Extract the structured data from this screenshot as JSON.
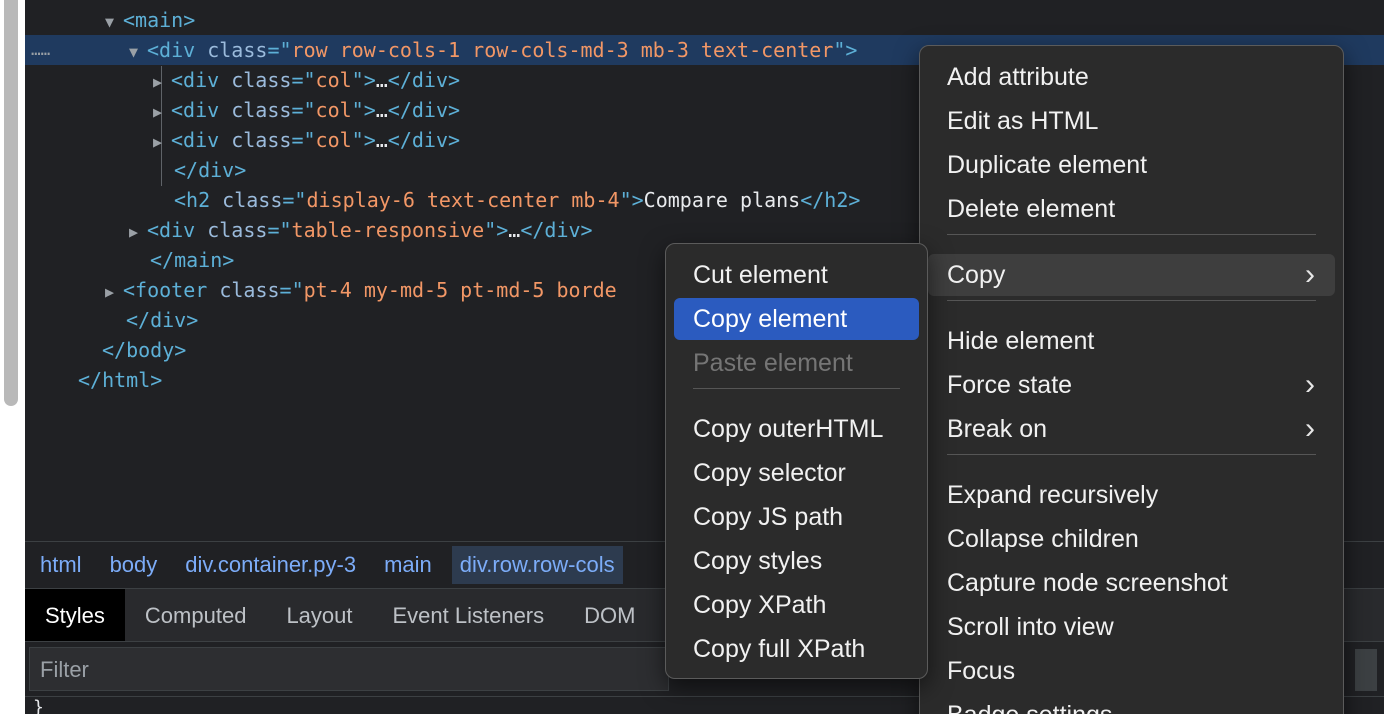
{
  "dom_tree": {
    "lines": [
      {
        "indent": 80,
        "arrow": "▼",
        "parts": [
          {
            "c": "tag",
            "t": "<main>"
          }
        ]
      },
      {
        "indent": 104,
        "arrow": "▼",
        "selected": true,
        "parts": [
          {
            "c": "tag",
            "t": "<div "
          },
          {
            "c": "attr",
            "t": "class"
          },
          {
            "c": "tag",
            "t": "=\""
          },
          {
            "c": "val",
            "t": "row row-cols-1 row-cols-md-3 mb-3 text-center"
          },
          {
            "c": "tag",
            "t": "\">"
          }
        ]
      },
      {
        "indent": 128,
        "arrow": "▶",
        "parts": [
          {
            "c": "tag",
            "t": "<div "
          },
          {
            "c": "attr",
            "t": "class"
          },
          {
            "c": "tag",
            "t": "=\""
          },
          {
            "c": "val",
            "t": "col"
          },
          {
            "c": "tag",
            "t": "\">"
          },
          {
            "c": "txt",
            "t": "…"
          },
          {
            "c": "tag",
            "t": "</div>"
          }
        ]
      },
      {
        "indent": 128,
        "arrow": "▶",
        "parts": [
          {
            "c": "tag",
            "t": "<div "
          },
          {
            "c": "attr",
            "t": "class"
          },
          {
            "c": "tag",
            "t": "=\""
          },
          {
            "c": "val",
            "t": "col"
          },
          {
            "c": "tag",
            "t": "\">"
          },
          {
            "c": "txt",
            "t": "…"
          },
          {
            "c": "tag",
            "t": "</div>"
          }
        ]
      },
      {
        "indent": 128,
        "arrow": "▶",
        "parts": [
          {
            "c": "tag",
            "t": "<div "
          },
          {
            "c": "attr",
            "t": "class"
          },
          {
            "c": "tag",
            "t": "=\""
          },
          {
            "c": "val",
            "t": "col"
          },
          {
            "c": "tag",
            "t": "\">"
          },
          {
            "c": "txt",
            "t": "…"
          },
          {
            "c": "tag",
            "t": "</div>"
          }
        ]
      },
      {
        "indent": 125,
        "arrow": "",
        "parts": [
          {
            "c": "tag",
            "t": "</div>"
          }
        ]
      },
      {
        "indent": 125,
        "arrow": "",
        "parts": [
          {
            "c": "tag",
            "t": "<h2 "
          },
          {
            "c": "attr",
            "t": "class"
          },
          {
            "c": "tag",
            "t": "=\""
          },
          {
            "c": "val",
            "t": "display-6 text-center mb-4"
          },
          {
            "c": "tag",
            "t": "\">"
          },
          {
            "c": "txt",
            "t": "Compare plans"
          },
          {
            "c": "tag",
            "t": "</h2>"
          }
        ]
      },
      {
        "indent": 104,
        "arrow": "▶",
        "parts": [
          {
            "c": "tag",
            "t": "<div "
          },
          {
            "c": "attr",
            "t": "class"
          },
          {
            "c": "tag",
            "t": "=\""
          },
          {
            "c": "val",
            "t": "table-responsive"
          },
          {
            "c": "tag",
            "t": "\">"
          },
          {
            "c": "txt",
            "t": "…"
          },
          {
            "c": "tag",
            "t": "</div>"
          }
        ]
      },
      {
        "indent": 101,
        "arrow": "",
        "parts": [
          {
            "c": "tag",
            "t": "</main>"
          }
        ]
      },
      {
        "indent": 80,
        "arrow": "▶",
        "parts": [
          {
            "c": "tag",
            "t": "<footer "
          },
          {
            "c": "attr",
            "t": "class"
          },
          {
            "c": "tag",
            "t": "=\""
          },
          {
            "c": "val",
            "t": "pt-4 my-md-5 pt-md-5 borde"
          }
        ]
      },
      {
        "indent": 77,
        "arrow": "",
        "parts": [
          {
            "c": "tag",
            "t": "</div>"
          }
        ]
      },
      {
        "indent": 53,
        "arrow": "",
        "parts": [
          {
            "c": "tag",
            "t": "</body>"
          }
        ]
      },
      {
        "indent": 29,
        "arrow": "",
        "parts": [
          {
            "c": "tag",
            "t": "</html>"
          }
        ]
      }
    ],
    "ellipsis": "…"
  },
  "breadcrumb": [
    "html",
    "body",
    "div.container.py-3",
    "main",
    "div.row.row-cols"
  ],
  "tabs": [
    {
      "label": "Styles",
      "active": true
    },
    {
      "label": "Computed"
    },
    {
      "label": "Layout"
    },
    {
      "label": "Event Listeners"
    },
    {
      "label": "DOM"
    }
  ],
  "filter": {
    "placeholder": "Filter"
  },
  "bottom_text": "}",
  "context_menu": {
    "items": [
      {
        "label": "Add attribute"
      },
      {
        "label": "Edit as HTML"
      },
      {
        "label": "Duplicate element"
      },
      {
        "label": "Delete element"
      },
      {
        "sep": true
      },
      {
        "label": "Copy",
        "submenu": true,
        "hover": true
      },
      {
        "sep": true
      },
      {
        "label": "Hide element"
      },
      {
        "label": "Force state",
        "submenu": true
      },
      {
        "label": "Break on",
        "submenu": true
      },
      {
        "sep": true
      },
      {
        "label": "Expand recursively"
      },
      {
        "label": "Collapse children"
      },
      {
        "label": "Capture node screenshot"
      },
      {
        "label": "Scroll into view"
      },
      {
        "label": "Focus"
      },
      {
        "label": "Badge settings..."
      }
    ]
  },
  "copy_submenu": {
    "items": [
      {
        "label": "Cut element"
      },
      {
        "label": "Copy element",
        "selected": true
      },
      {
        "label": "Paste element",
        "disabled": true
      },
      {
        "sep": true
      },
      {
        "label": "Copy outerHTML"
      },
      {
        "label": "Copy selector"
      },
      {
        "label": "Copy JS path"
      },
      {
        "label": "Copy styles"
      },
      {
        "label": "Copy XPath"
      },
      {
        "label": "Copy full XPath"
      }
    ]
  },
  "icons": {
    "chevron": "›"
  }
}
